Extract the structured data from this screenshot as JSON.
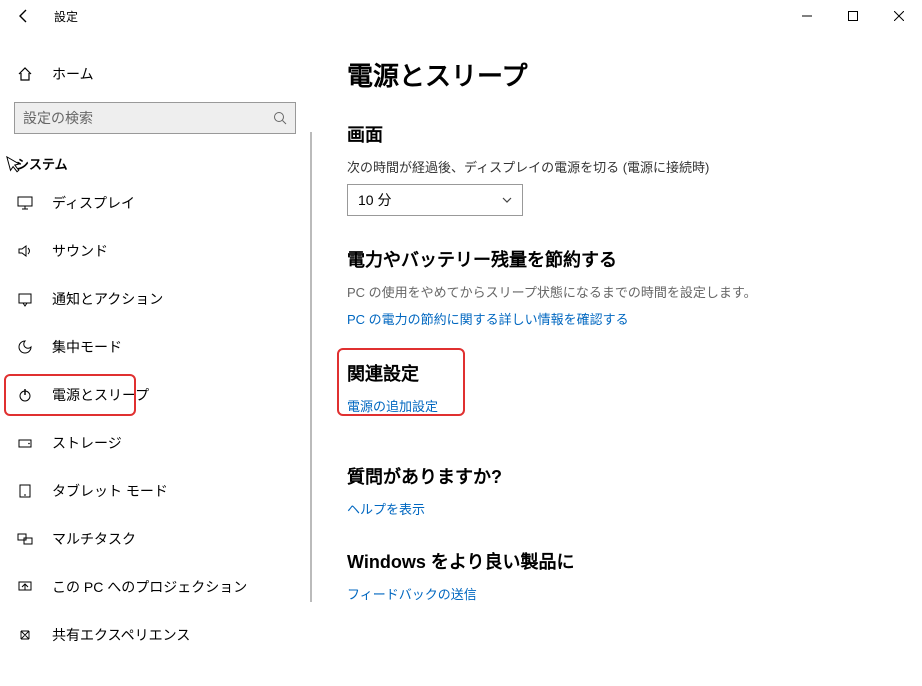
{
  "window": {
    "title": "設定"
  },
  "sidebar": {
    "home_label": "ホーム",
    "search_placeholder": "設定の検索",
    "group_label": "システム",
    "items": [
      {
        "label": "ディスプレイ",
        "icon": "display"
      },
      {
        "label": "サウンド",
        "icon": "sound"
      },
      {
        "label": "通知とアクション",
        "icon": "notify"
      },
      {
        "label": "集中モード",
        "icon": "focus"
      },
      {
        "label": "電源とスリープ",
        "icon": "power",
        "selected": true
      },
      {
        "label": "ストレージ",
        "icon": "storage"
      },
      {
        "label": "タブレット モード",
        "icon": "tablet"
      },
      {
        "label": "マルチタスク",
        "icon": "multitask"
      },
      {
        "label": "この PC へのプロジェクション",
        "icon": "project"
      },
      {
        "label": "共有エクスペリエンス",
        "icon": "share"
      }
    ]
  },
  "main": {
    "title": "電源とスリープ",
    "screen_section": "画面",
    "screen_desc": "次の時間が経過後、ディスプレイの電源を切る (電源に接続時)",
    "screen_select_value": "10 分",
    "save_section": "電力やバッテリー残量を節約する",
    "save_desc": "PC の使用をやめてからスリープ状態になるまでの時間を設定します。",
    "save_link": "PC の電力の節約に関する詳しい情報を確認する",
    "related_section": "関連設定",
    "related_link": "電源の追加設定",
    "help_section": "質問がありますか?",
    "help_link": "ヘルプを表示",
    "feedback_section": "Windows をより良い製品に",
    "feedback_link": "フィードバックの送信"
  }
}
